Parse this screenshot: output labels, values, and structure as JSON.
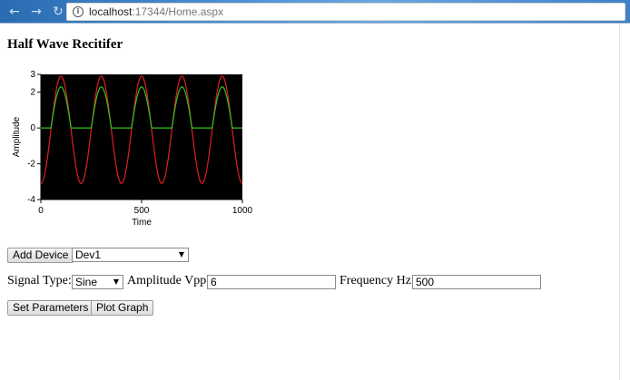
{
  "browser": {
    "url_host": "localhost",
    "url_path": ":17344/Home.aspx"
  },
  "page": {
    "title": "Half Wave Recitifer"
  },
  "chart_data": {
    "type": "line",
    "xlabel": "Time",
    "ylabel": "Amplitude",
    "xlim": [
      0,
      1000
    ],
    "ylim": [
      -4,
      3
    ],
    "xticks": [
      "0",
      "500",
      "1000"
    ],
    "yticks": [
      "3",
      "2",
      "0",
      "-2",
      "-4"
    ],
    "background": "#000000",
    "series": [
      {
        "color": "#e0201e",
        "amplitude": 3,
        "offset": -0.1,
        "period": 200,
        "phase_start": "trough-ish",
        "kind": "sine"
      },
      {
        "color": "#2fc21e",
        "amplitude": 2.3,
        "period": 200,
        "kind": "half-wave-rectified"
      }
    ],
    "grid": false,
    "legend": "none"
  },
  "device": {
    "add_button": "Add Device",
    "selected": "Dev1"
  },
  "params": {
    "signal_type_label": "Signal Type:",
    "signal_type_value": "Sine",
    "amplitude_label": "Amplitude Vpp:",
    "amplitude_value": "6",
    "frequency_label": "Frequency Hz:",
    "frequency_value": "500"
  },
  "actions": {
    "set_parameters": "Set Parameters",
    "plot_graph": "Plot Graph"
  }
}
